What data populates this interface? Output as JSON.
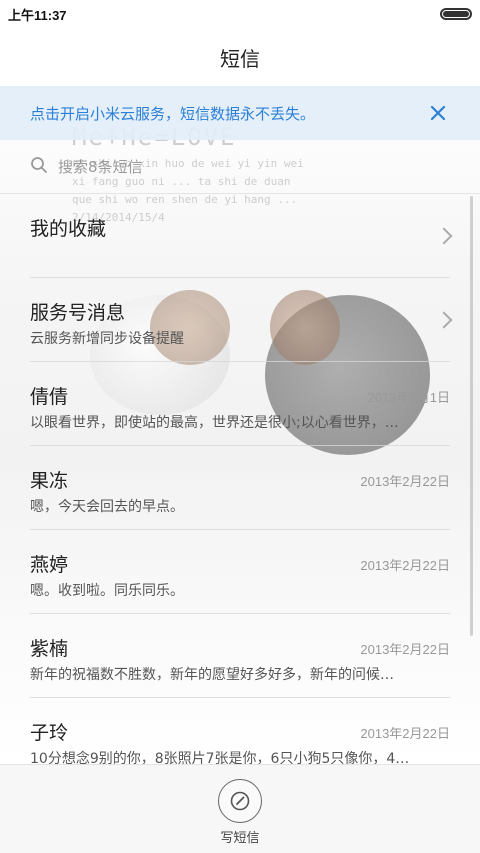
{
  "status": {
    "time": "上午11:37"
  },
  "header": {
    "title": "短信"
  },
  "banner": {
    "text": "点击开启小米云服务，短信数据永不丢失。"
  },
  "search": {
    "placeholder": "搜索8条短信"
  },
  "wallpaper": {
    "title": "Me+He=LOVE",
    "lines": [
      "ni shi wo xin huo de wei yi yin wei",
      "xi fang guo ni ... ta shi de duan",
      "que shi wo ren shen de yi hang ...",
      "2/14/2014/15/4"
    ]
  },
  "items": [
    {
      "name": "我的收藏",
      "preview": "",
      "date": ""
    },
    {
      "name": "服务号消息",
      "preview": "云服务新增同步设备提醒",
      "date": ""
    },
    {
      "name": "倩倩",
      "preview": "以眼看世界，即使站的最高，世界还是很小;以心看世界，…",
      "date": "2013年3月1日"
    },
    {
      "name": "果冻",
      "preview": "嗯，今天会回去的早点。",
      "date": "2013年2月22日"
    },
    {
      "name": "燕婷",
      "preview": "嗯。收到啦。同乐同乐。",
      "date": "2013年2月22日"
    },
    {
      "name": "紫楠",
      "preview": "新年的祝福数不胜数，新年的愿望好多好多，新年的问候…",
      "date": "2013年2月22日"
    },
    {
      "name": "子玲",
      "preview": "10分想念9别的你，8张照片7张是你，6只小狗5只像你，4…",
      "date": "2013年2月22日"
    }
  ],
  "footer": {
    "compose_label": "写短信"
  },
  "colors": {
    "accent": "#2a7fd6",
    "banner_bg": "#e3eefa"
  },
  "icons": {
    "search": "search-icon",
    "close": "close-icon",
    "chevron": "chevron-right-icon",
    "compose": "compose-icon"
  }
}
